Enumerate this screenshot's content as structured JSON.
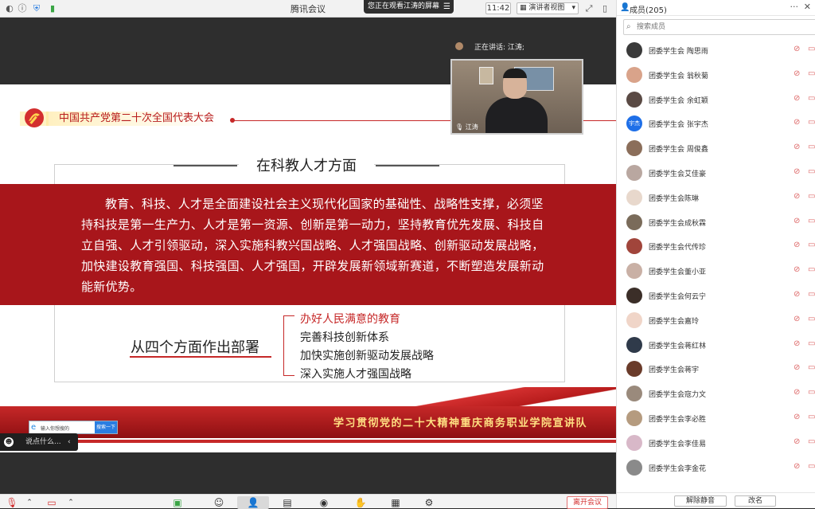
{
  "window": {
    "title": "腾讯会议"
  },
  "topbar": {
    "watch_banner": "您正在观看江涛的屏幕",
    "time": "11:42",
    "view_mode": "演讲者视图"
  },
  "speaker": {
    "speaking_label": "正在讲话: 江涛;",
    "name": "江涛"
  },
  "slide": {
    "congress_label": "中国共产党第二十次全国代表大会",
    "heading": "在科教人才方面",
    "paragraph": "教育、科技、人才是全面建设社会主义现代化国家的基础性、战略性支撑，必须坚持科技是第一生产力、人才是第一资源、创新是第一动力，坚持教育优先发展、科技自立自强、人才引领驱动，深入实施科教兴国战略、人才强国战略、创新驱动发展战略，加快建设教育强国、科技强国、人才强国，开辟发展新领域新赛道，不断塑造发展新动能新优势。",
    "deploy_title": "从四个方面作出部署",
    "points": [
      "办好人民满意的教育",
      "完善科技创新体系",
      "加快实施创新驱动发展战略",
      "深入实施人才强国战略"
    ],
    "slogan": "学习贯彻党的二十大精神重庆商务职业学院宣讲队",
    "search_ad": {
      "placeholder": "输入你想搜的",
      "button": "搜索一下"
    }
  },
  "chat": {
    "placeholder": "说点什么..."
  },
  "toolbar": {
    "leave_label": "离开会议"
  },
  "panel": {
    "title": "成员(205)",
    "search_placeholder": "搜索成员",
    "members": [
      {
        "name": "团委学生会 陶思雨",
        "avatar": ""
      },
      {
        "name": "团委学生会 翁秋菊",
        "avatar": ""
      },
      {
        "name": "团委学生会 余虹颖",
        "avatar": ""
      },
      {
        "name": "团委学生会 张宇杰",
        "avatar": "宇杰"
      },
      {
        "name": "团委学生会 周俊鑫",
        "avatar": ""
      },
      {
        "name": "团委学生会艾佳豪",
        "avatar": ""
      },
      {
        "name": "团委学生会陈琳",
        "avatar": ""
      },
      {
        "name": "团委学生会成秋霖",
        "avatar": ""
      },
      {
        "name": "团委学生会代传珍",
        "avatar": ""
      },
      {
        "name": "团委学生会董小亚",
        "avatar": ""
      },
      {
        "name": "团委学生会何云宁",
        "avatar": ""
      },
      {
        "name": "团委学生会嘉玲",
        "avatar": ""
      },
      {
        "name": "团委学生会蒋红林",
        "avatar": ""
      },
      {
        "name": "团委学生会蒋宇",
        "avatar": ""
      },
      {
        "name": "团委学生会寇力文",
        "avatar": ""
      },
      {
        "name": "团委学生会李必胜",
        "avatar": ""
      },
      {
        "name": "团委学生会李佳易",
        "avatar": ""
      },
      {
        "name": "团委学生会李金花",
        "avatar": ""
      }
    ],
    "footer": {
      "unmute_all": "解除静音",
      "rename": "改名"
    }
  },
  "colors": {
    "accent_red": "#a8161b",
    "slide_red": "#c62828",
    "member_blue": "#1e6fe8"
  }
}
